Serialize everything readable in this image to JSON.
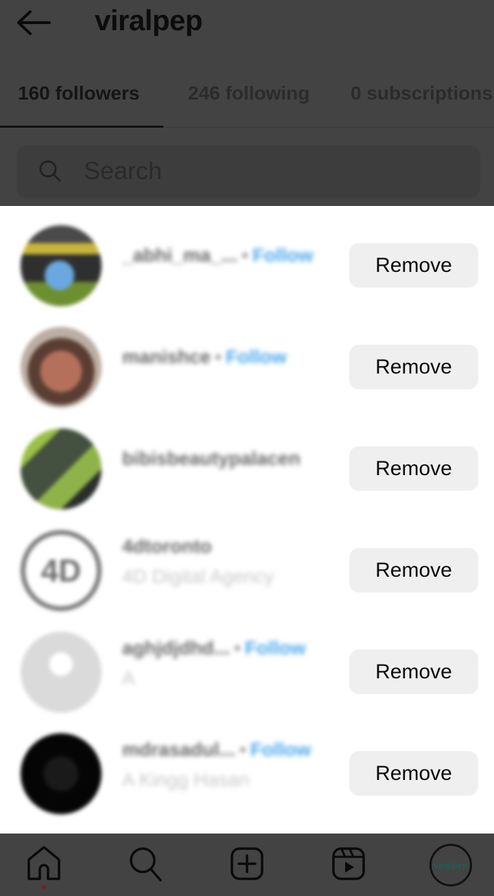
{
  "header": {
    "back_icon": "arrow-left-icon",
    "title": "viralpep"
  },
  "tabs": [
    {
      "label": "160 followers",
      "active": true
    },
    {
      "label": "246 following",
      "active": false
    },
    {
      "label": "0 subscriptions",
      "active": false
    }
  ],
  "search": {
    "icon": "search-icon",
    "placeholder": "Search"
  },
  "followers": [
    {
      "username": "_abhi_ma_...",
      "follow_label": "Follow",
      "subtitle": "",
      "remove_label": "Remove"
    },
    {
      "username": "manishce",
      "follow_label": "Follow",
      "subtitle": "",
      "remove_label": "Remove"
    },
    {
      "username": "bibisbeautypalacen",
      "follow_label": "",
      "subtitle": "",
      "remove_label": "Remove"
    },
    {
      "username": "4dtoronto",
      "follow_label": "",
      "subtitle": "4D Digital Agency",
      "remove_label": "Remove",
      "avatar_text": "4D"
    },
    {
      "username": "aghjdjdhd...",
      "follow_label": "Follow",
      "subtitle": "A",
      "remove_label": "Remove"
    },
    {
      "username": "mdrasadul...",
      "follow_label": "Follow",
      "subtitle": "A Kingg Hasan",
      "remove_label": "Remove"
    }
  ],
  "separator": "•",
  "bottom_nav": {
    "items": [
      {
        "name": "home",
        "icon": "home-icon",
        "active": true
      },
      {
        "name": "search",
        "icon": "search-icon"
      },
      {
        "name": "new-post",
        "icon": "plus-square-icon"
      },
      {
        "name": "reels",
        "icon": "reels-icon"
      },
      {
        "name": "profile",
        "icon": "profile-avatar",
        "label": "viralpep"
      }
    ]
  },
  "colors": {
    "overlay_dim": "#434343",
    "follow_blue": "#4aa8ee",
    "button_bg": "#efefef"
  }
}
